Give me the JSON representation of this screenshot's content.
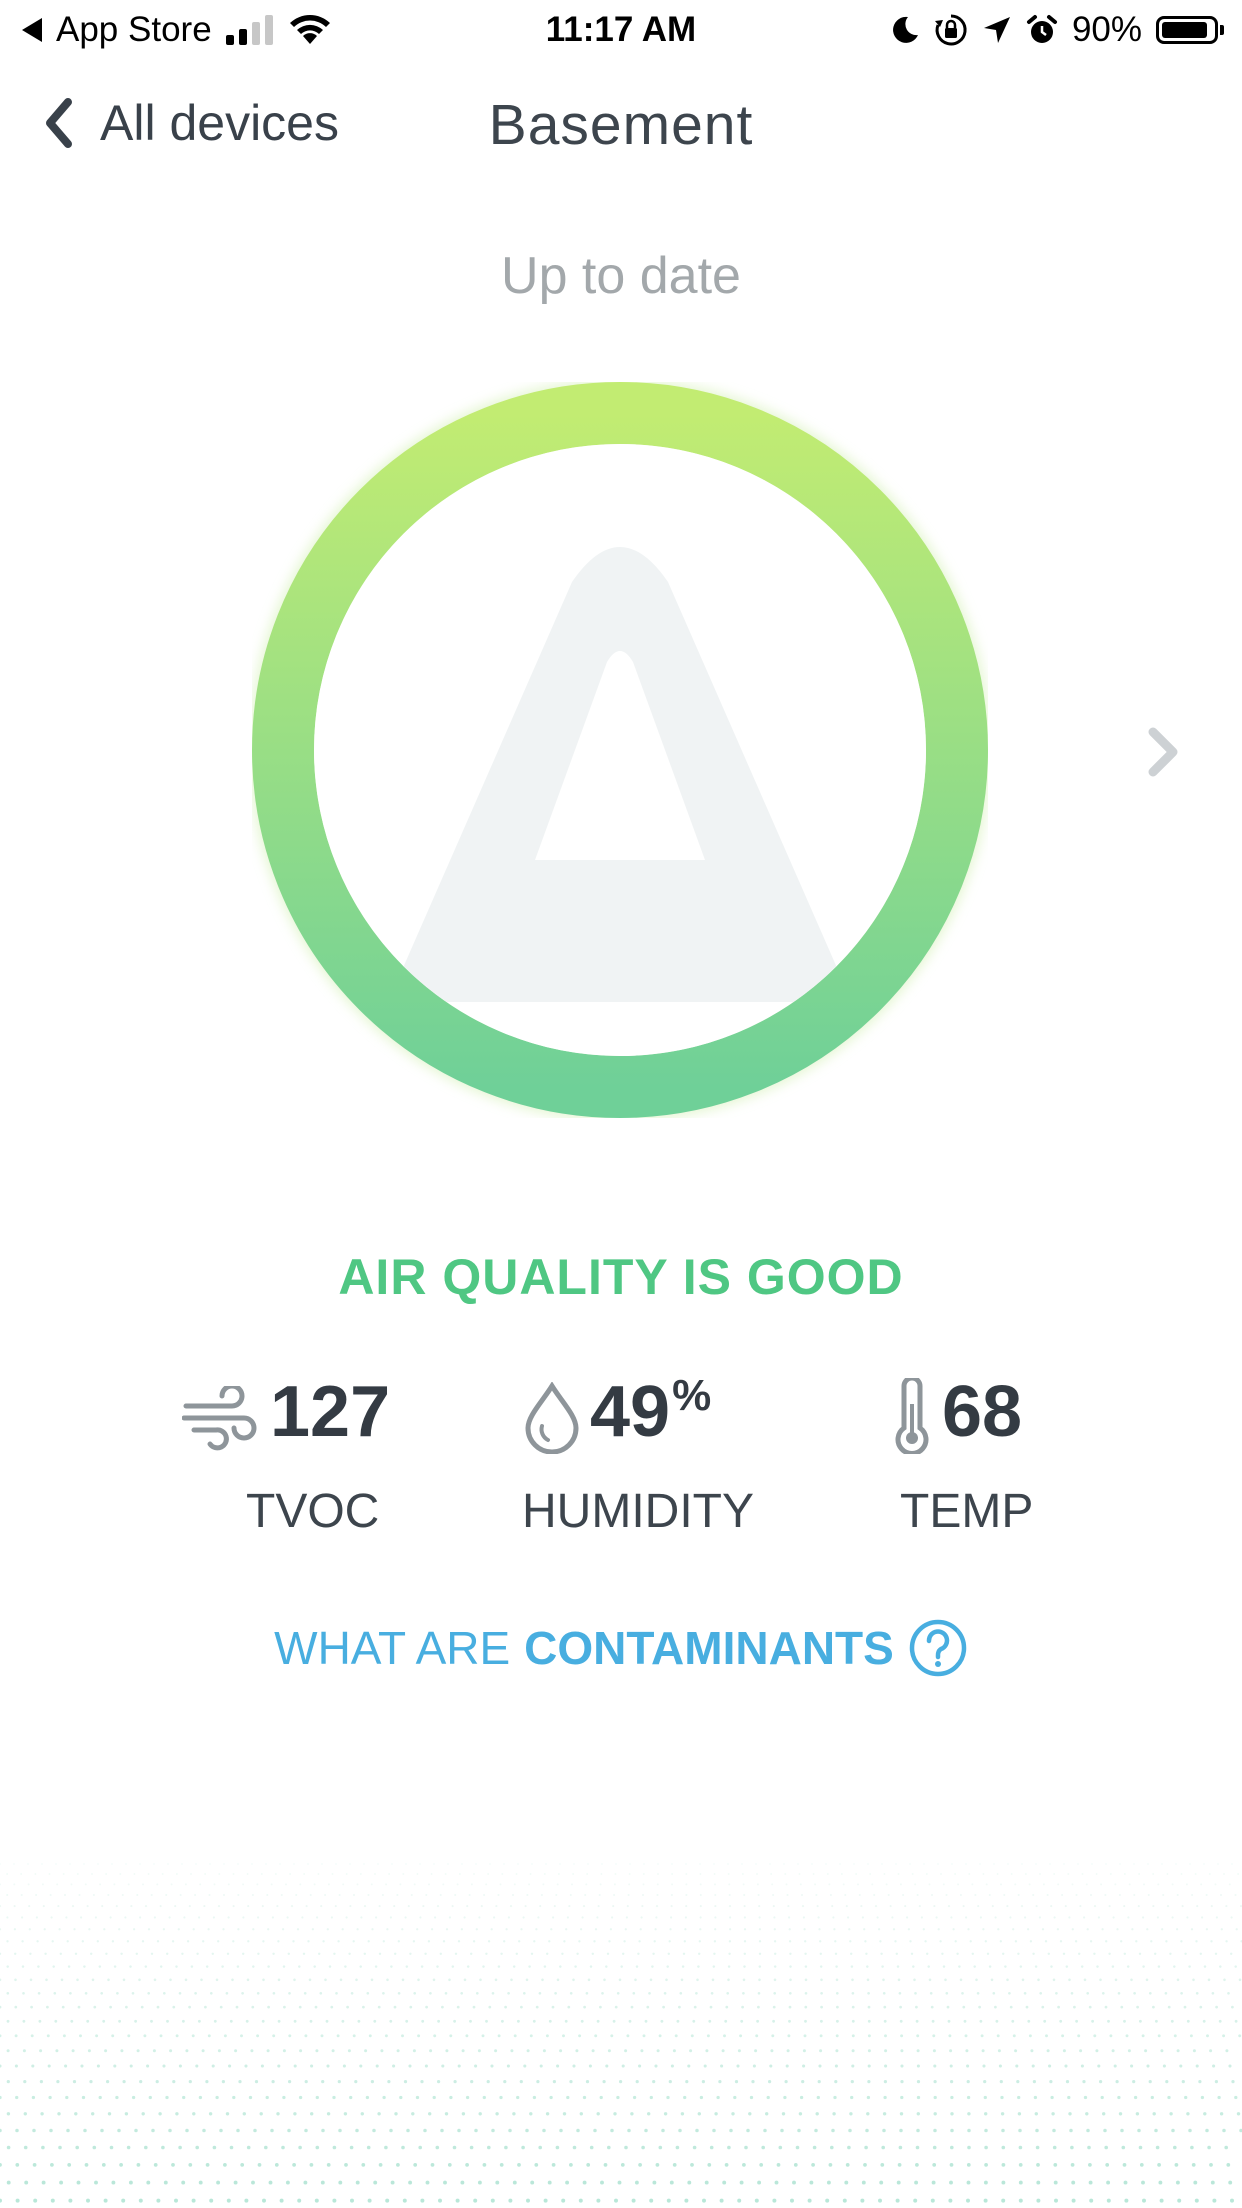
{
  "status_bar": {
    "back_app": "App Store",
    "time": "11:17 AM",
    "battery_text": "90%",
    "battery_level": 0.9
  },
  "nav": {
    "back_label": "All devices",
    "title": "Basement"
  },
  "update_status": "Up to date",
  "quality": {
    "label": "AIR QUALITY IS GOOD",
    "color": "#4fc783",
    "ring_gradient": [
      "#c2ec72",
      "#6fd098"
    ]
  },
  "metrics": {
    "tvoc": {
      "value": "127",
      "label": "TVOC",
      "icon": "wind-icon"
    },
    "humidity": {
      "value": "49",
      "unit": "%",
      "label": "HUMIDITY",
      "icon": "droplet-icon"
    },
    "temp": {
      "value": "68",
      "label": "TEMP",
      "icon": "thermometer-icon"
    }
  },
  "contaminants": {
    "prefix": "WHAT ARE",
    "bold": "CONTAMINANTS",
    "icon": "question-circle-icon",
    "color": "#48aee0"
  }
}
